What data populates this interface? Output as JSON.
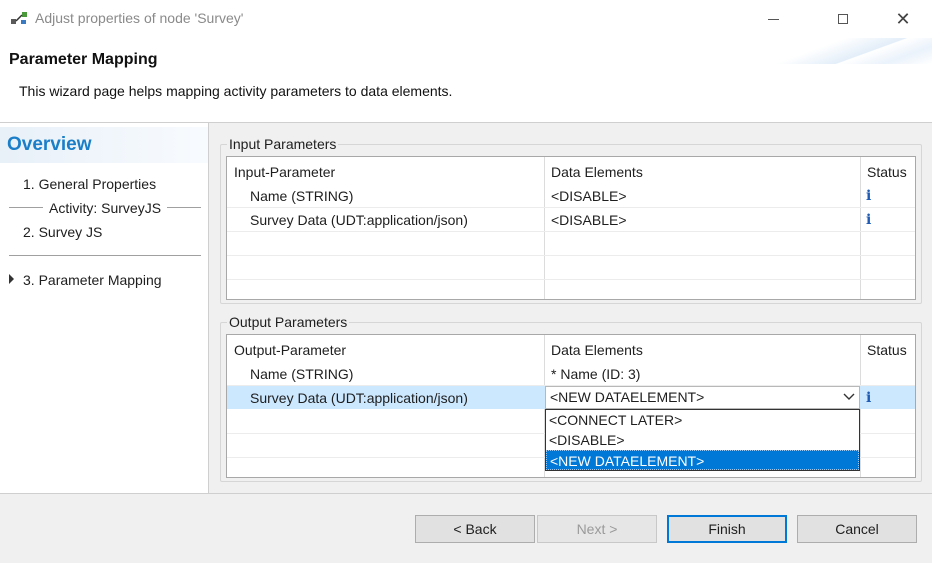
{
  "window": {
    "title": "Adjust properties of node 'Survey'",
    "controls": [
      "minimize-icon",
      "maximize-icon",
      "close-icon"
    ]
  },
  "header": {
    "title": "Parameter Mapping",
    "description": "This wizard page helps mapping activity parameters to data elements."
  },
  "nav": {
    "overview": "Overview",
    "items": [
      {
        "label": "1.  General Properties"
      },
      {
        "label": "Activity: SurveyJS"
      },
      {
        "label": "2.  Survey JS"
      },
      {
        "label": "3.  Parameter Mapping"
      }
    ]
  },
  "input_group": {
    "label": "Input Parameters",
    "headers": {
      "param": "Input-Parameter",
      "data": "Data Elements",
      "status": "Status"
    },
    "rows": [
      {
        "param": "Name  (STRING)",
        "data": "<DISABLE>",
        "status_icon": "info-icon",
        "status": "i"
      },
      {
        "param": "Survey Data  (UDT:application/json)",
        "data": "<DISABLE>",
        "status_icon": "info-icon",
        "status": "i"
      }
    ]
  },
  "output_group": {
    "label": "Output Parameters",
    "headers": {
      "param": "Output-Parameter",
      "data": "Data Elements",
      "status": "Status"
    },
    "rows": [
      {
        "param": "Name  (STRING)",
        "data": "* Name  (ID: 3)"
      },
      {
        "param": "Survey Data  (UDT:application/json)",
        "data": "<NEW DATAELEMENT>",
        "status_icon": "info-icon",
        "status": "i"
      }
    ],
    "dropdown_options": [
      "<CONNECT LATER>",
      "<DISABLE>",
      "<NEW DATAELEMENT>"
    ],
    "selected_option": "<NEW DATAELEMENT>"
  },
  "buttons": {
    "back": "< Back",
    "next": "Next >",
    "finish": "Finish",
    "cancel": "Cancel"
  },
  "colors": {
    "accent": "#0078d7",
    "overview_text": "#1a7fc8",
    "selected_row": "#cce8ff",
    "info_icon": "#1f5bb5"
  }
}
